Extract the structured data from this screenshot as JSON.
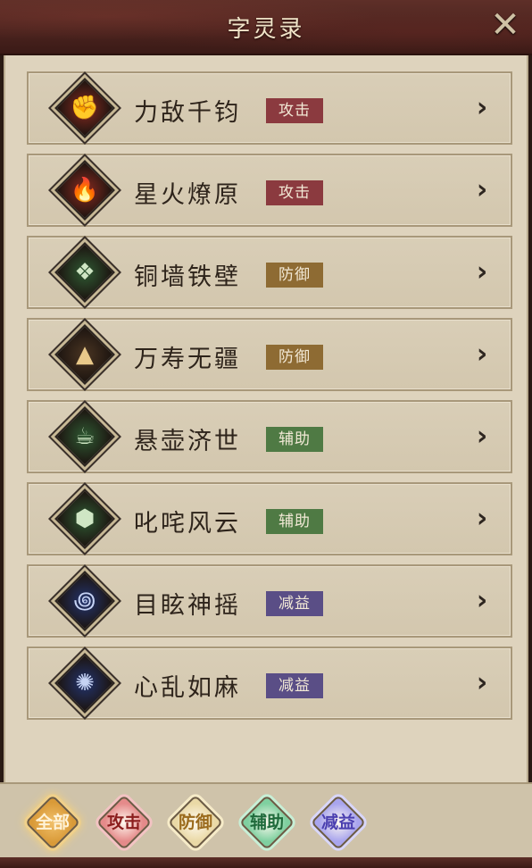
{
  "header": {
    "title": "字灵录",
    "close_label": "✕"
  },
  "rows": [
    {
      "name": "力敌千钧",
      "tag": "攻击",
      "tag_color": "#8b3a3f",
      "icon": "fist-icon",
      "icon_glyph": "✊",
      "icon_bg": "#8a2a20",
      "icon_fg": "#f4c9b0"
    },
    {
      "name": "星火燎原",
      "tag": "攻击",
      "tag_color": "#8b3a3f",
      "icon": "flame-icon",
      "icon_glyph": "🔥",
      "icon_bg": "#8a2a20",
      "icon_fg": "#f4b08a"
    },
    {
      "name": "铜墙铁壁",
      "tag": "防御",
      "tag_color": "#8e6b33",
      "icon": "shield-icon",
      "icon_glyph": "❖",
      "icon_bg": "#2f5a33",
      "icon_fg": "#cfe6c4"
    },
    {
      "name": "万寿无疆",
      "tag": "防御",
      "tag_color": "#8e6b33",
      "icon": "crown-icon",
      "icon_glyph": "▲",
      "icon_bg": "#4a3522",
      "icon_fg": "#e9c98a"
    },
    {
      "name": "悬壶济世",
      "tag": "辅助",
      "tag_color": "#4f7a44",
      "icon": "teapot-icon",
      "icon_glyph": "☕",
      "icon_bg": "#2f5a33",
      "icon_fg": "#cfe6c4"
    },
    {
      "name": "叱咤风云",
      "tag": "辅助",
      "tag_color": "#4f7a44",
      "icon": "helmet-icon",
      "icon_glyph": "⬢",
      "icon_bg": "#2f5a33",
      "icon_fg": "#cfe6c4"
    },
    {
      "name": "目眩神摇",
      "tag": "减益",
      "tag_color": "#5a4e86",
      "icon": "spiral-icon",
      "icon_glyph": "꩜",
      "icon_bg": "#23346e",
      "icon_fg": "#c6d3f4"
    },
    {
      "name": "心乱如麻",
      "tag": "减益",
      "tag_color": "#5a4e86",
      "icon": "tangle-icon",
      "icon_glyph": "✺",
      "icon_bg": "#23346e",
      "icon_fg": "#c6d3f4"
    }
  ],
  "row_chevron": "›",
  "filters": [
    {
      "label": "全部",
      "bg": "#d99a38",
      "fg": "#fff3d8",
      "border": "#f0d08a",
      "selected": true
    },
    {
      "label": "攻击",
      "bg": "#e58a8a",
      "fg": "#8b1d1d",
      "border": "#f3c3c3",
      "selected": false
    },
    {
      "label": "防御",
      "bg": "#ead9a6",
      "fg": "#9a6a1c",
      "border": "#f6ebc8",
      "selected": false
    },
    {
      "label": "辅助",
      "bg": "#7fd0a0",
      "fg": "#1f6a3b",
      "border": "#c7efd6",
      "selected": false
    },
    {
      "label": "减益",
      "bg": "#a9a5ee",
      "fg": "#4a3fb0",
      "border": "#d8d6fa",
      "selected": false
    }
  ]
}
